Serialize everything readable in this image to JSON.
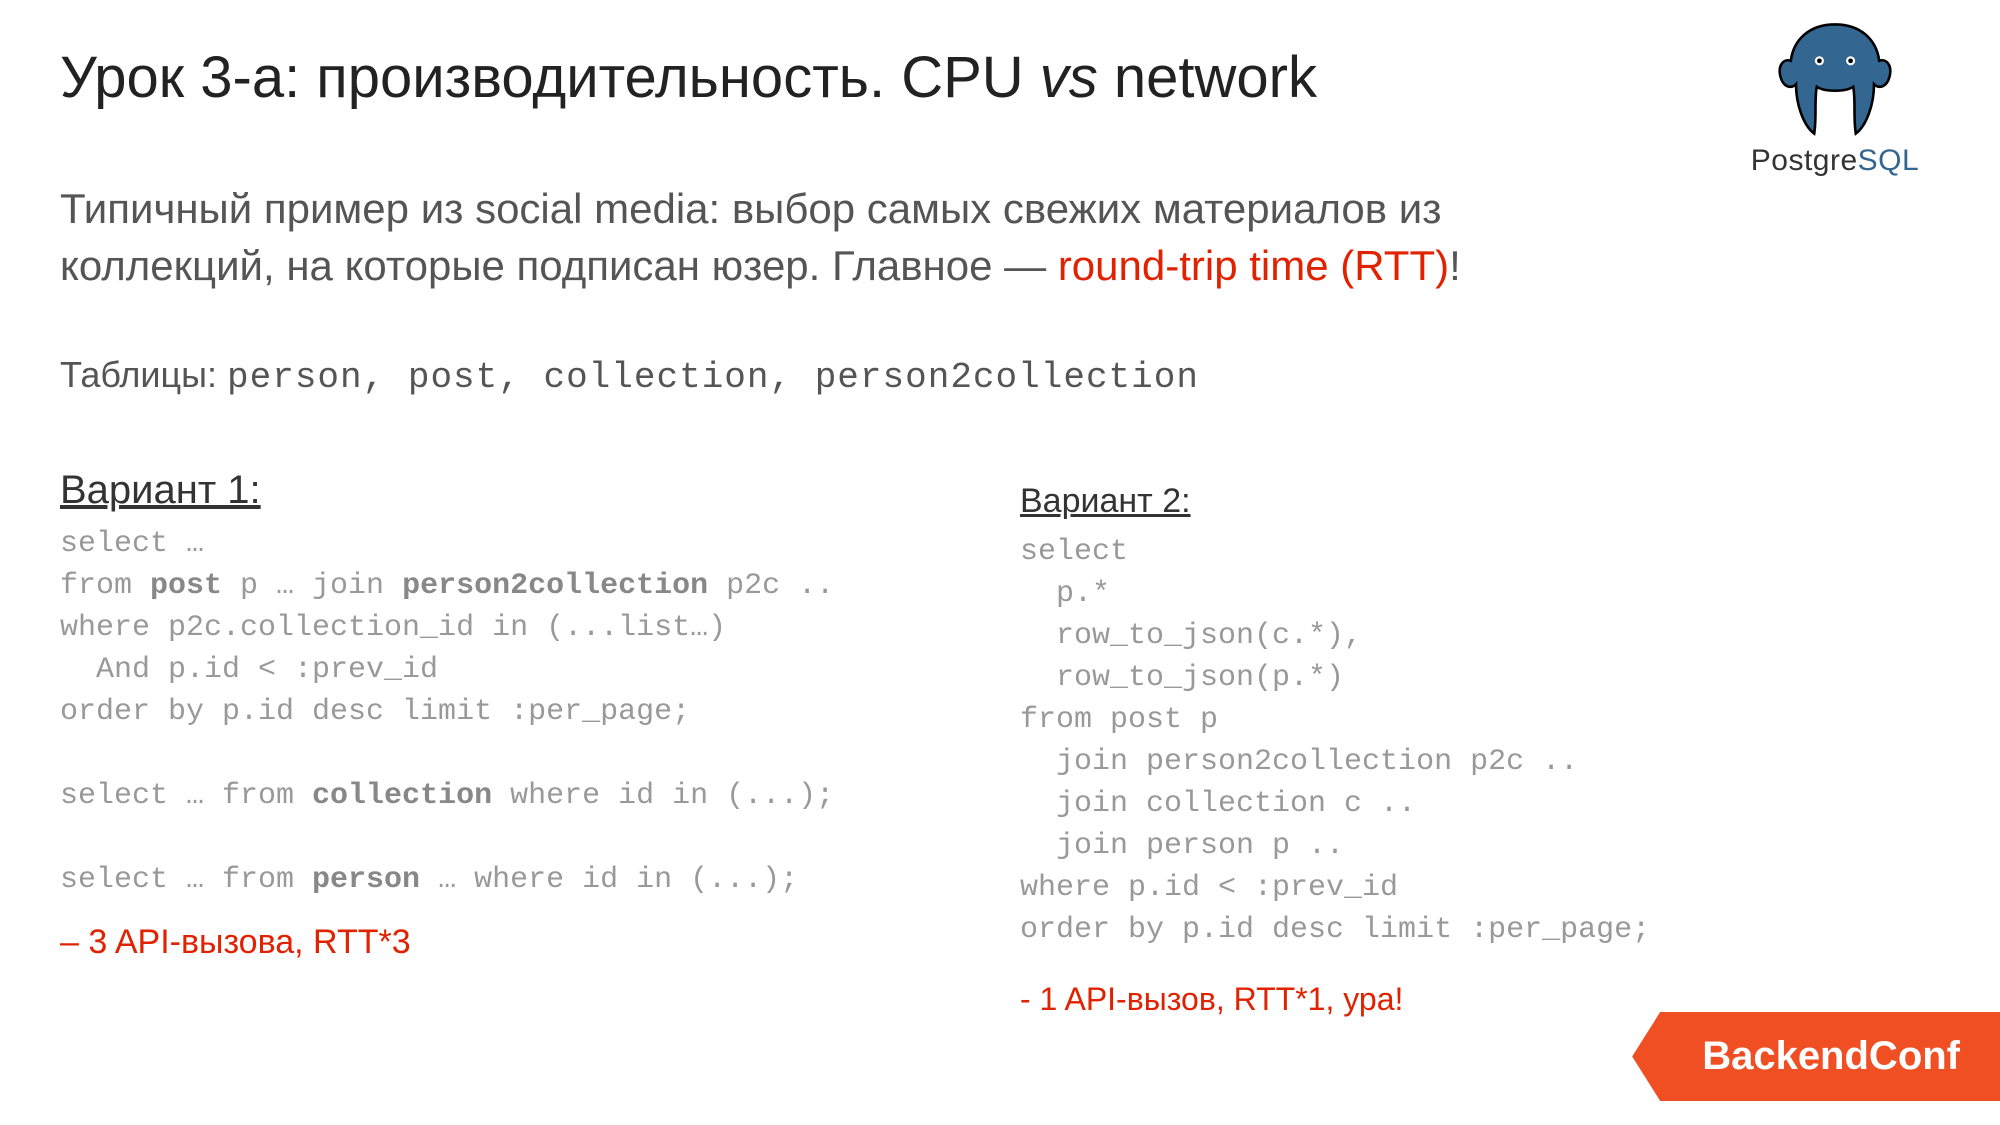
{
  "title_prefix": "Урок 3-а: производительность. CPU ",
  "title_vs": "vs",
  "title_suffix": " network",
  "logo": {
    "name_prefix": "Postgre",
    "name_sql": "SQL"
  },
  "intro_plain": "Типичный пример из social media: выбор самых свежих материалов из коллекций, на которые подписан юзер. Главное — ",
  "intro_red": "round-trip time (RTT)",
  "intro_bang": "!",
  "tables_label": "Таблицы: ",
  "tables_list": "person, post, collection, person2collection",
  "variant1": {
    "heading": "Вариант 1:",
    "l1a": "select …",
    "l2a": "from ",
    "l2b": "post",
    "l2c": " p … join ",
    "l2d": "person2collection",
    "l2e": " p2c ..",
    "l3": "where p2c.collection_id in (...list…)",
    "l4": "  And p.id < :prev_id",
    "l5": "order by p.id desc limit :per_page;",
    "blank1": "",
    "l6a": "select … from ",
    "l6b": "collection",
    "l6c": " where id in (...);",
    "blank2": "",
    "l7a": "select … from ",
    "l7b": "person",
    "l7c": " … where id in (...);",
    "result": "– 3 API-вызова, RTT*3"
  },
  "variant2": {
    "heading": "Вариант 2:",
    "code": "select\n  p.*\n  row_to_json(c.*),\n  row_to_json(p.*)\nfrom post p\n  join person2collection p2c ..\n  join collection c ..\n  join person p ..\nwhere p.id < :prev_id\norder by p.id desc limit :per_page;",
    "result": "- 1 API-вызов, RTT*1,  ура!"
  },
  "badge": "BackendConf"
}
